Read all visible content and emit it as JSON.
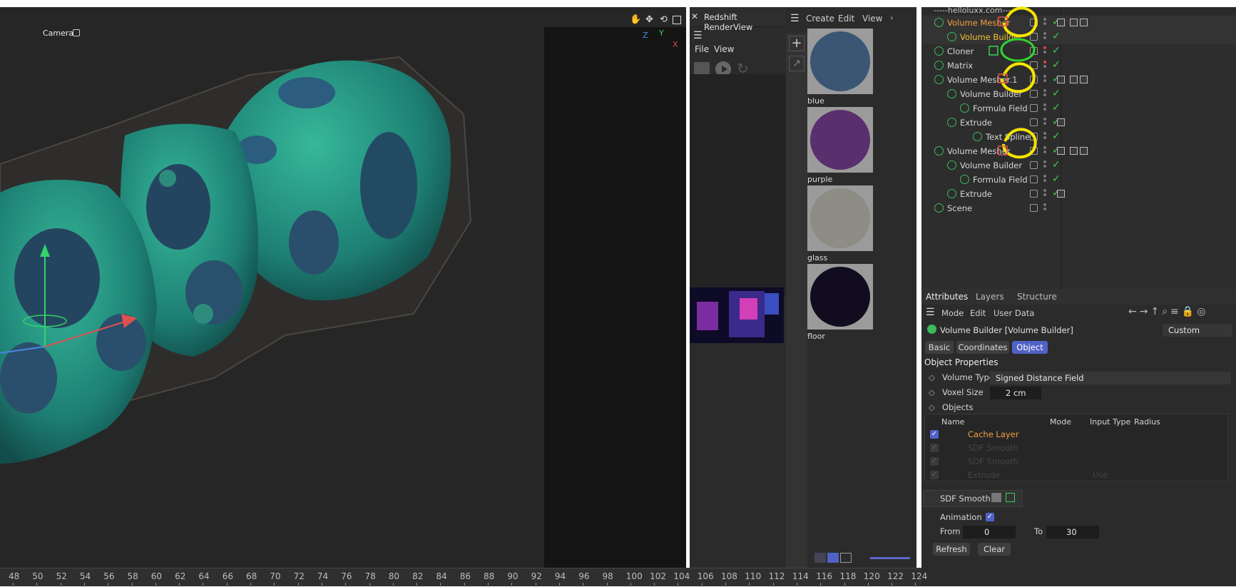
{
  "viewport": {
    "camera_label": "Camera",
    "axis_z": "Z",
    "axis_y": "Y",
    "axis_x": "X"
  },
  "renderview": {
    "title": "Redshift RenderView",
    "menu_file": "File",
    "menu_view": "View"
  },
  "materials": {
    "menu_create": "Create",
    "menu_edit": "Edit",
    "menu_view": "View",
    "items": [
      {
        "name": "blue",
        "color": "#3b5674"
      },
      {
        "name": "purple",
        "color": "#5a2f6e"
      },
      {
        "name": "glass",
        "color": "#8d8c85"
      },
      {
        "name": "floor",
        "color": "#120d1e"
      }
    ]
  },
  "object_manager": {
    "top_row": "-----helloluxx.com-----",
    "rows": [
      {
        "name": "Volume Mesher",
        "color": "#f0a040"
      },
      {
        "name": "Volume Builder",
        "color": "#f0c030"
      },
      {
        "name": "Cloner",
        "color": "#d6d6d6"
      },
      {
        "name": "Matrix",
        "color": "#d6d6d6"
      },
      {
        "name": "Volume Mesher.1",
        "color": "#d6d6d6"
      },
      {
        "name": "Volume Builder",
        "color": "#d6d6d6"
      },
      {
        "name": "Formula Field",
        "color": "#d6d6d6"
      },
      {
        "name": "Extrude",
        "color": "#d6d6d6"
      },
      {
        "name": "Text Spline",
        "color": "#d6d6d6"
      },
      {
        "name": "Volume Mesher",
        "color": "#d6d6d6"
      },
      {
        "name": "Volume Builder",
        "color": "#d6d6d6"
      },
      {
        "name": "Formula Field",
        "color": "#d6d6d6"
      },
      {
        "name": "Extrude",
        "color": "#d6d6d6"
      },
      {
        "name": "Scene",
        "color": "#d6d6d6"
      }
    ]
  },
  "attributes": {
    "tabs": [
      "Attributes",
      "Layers",
      "Structure"
    ],
    "menu_mode": "Mode",
    "menu_edit": "Edit",
    "menu_userdata": "User Data",
    "object_title": "Volume Builder [Volume Builder]",
    "preset": "Custom",
    "subtabs": [
      "Basic",
      "Coordinates",
      "Object"
    ],
    "section_title": "Object Properties",
    "volume_type_label": "Volume Type",
    "volume_type_value": "Signed Distance Field",
    "voxel_size_label": "Voxel Size",
    "voxel_size_value": "2 cm",
    "objects_label": "Objects",
    "list_headers": [
      "Name",
      "Mode",
      "Input Type",
      "Radius"
    ],
    "list_rows": [
      "Cache Layer",
      "SDF Smooth",
      "SDF Smooth",
      "Extrude"
    ],
    "list_row_extra": "Use",
    "sdf_smooth_label": "SDF Smooth",
    "animation_label": "Animation",
    "from_label": "From",
    "from_value": "0",
    "to_label": "To",
    "to_value": "30",
    "refresh_label": "Refresh",
    "clear_label": "Clear"
  },
  "timeline": {
    "ticks": [
      "48",
      "50",
      "52",
      "54",
      "56",
      "58",
      "60",
      "62",
      "64",
      "66",
      "68",
      "70",
      "72",
      "74",
      "76",
      "78",
      "80",
      "82",
      "84",
      "86",
      "88",
      "90",
      "92",
      "94",
      "96",
      "98",
      "100",
      "102",
      "104",
      "106",
      "108",
      "110",
      "112",
      "114",
      "116",
      "118",
      "120",
      "122",
      "124"
    ]
  },
  "colors": {
    "accent": "#5162c7",
    "check": "#3cd055",
    "orange_text": "#f0a040",
    "annotation_yellow": "#f5e400",
    "annotation_green": "#2fd52f"
  }
}
